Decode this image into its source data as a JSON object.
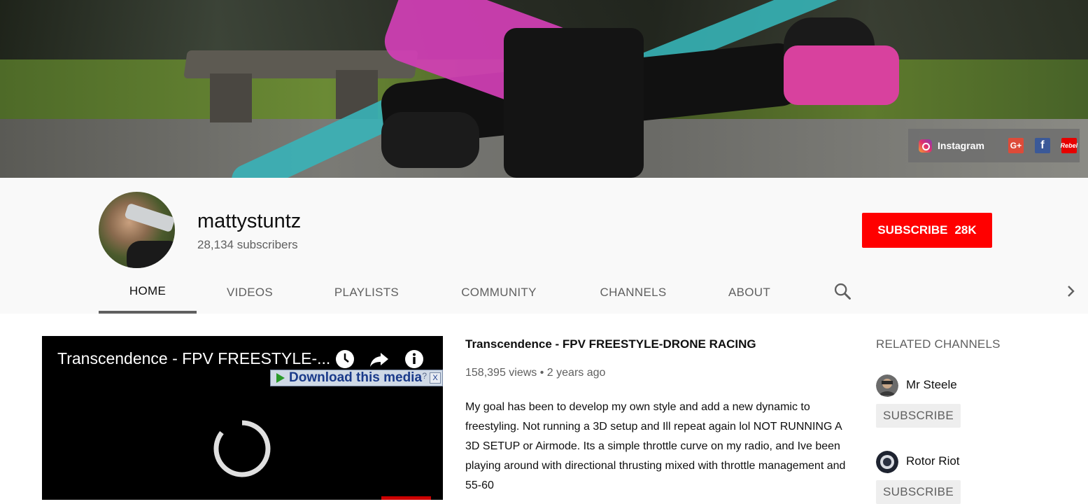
{
  "banner": {
    "links": {
      "instagram_label": "Instagram",
      "google_plus_label": "G+",
      "facebook_label": "f",
      "extra_label": "Rebel"
    }
  },
  "channel": {
    "name": "mattystuntz",
    "subscribers": "28,134 subscribers",
    "subscribe_label": "SUBSCRIBE",
    "subscribe_count": "28K"
  },
  "tabs": [
    {
      "label": "HOME",
      "active": true
    },
    {
      "label": "VIDEOS"
    },
    {
      "label": "PLAYLISTS"
    },
    {
      "label": "COMMUNITY"
    },
    {
      "label": "CHANNELS"
    },
    {
      "label": "ABOUT"
    }
  ],
  "player": {
    "title": "Transcendence - FPV FREESTYLE-...",
    "download_label": "Download this media",
    "download_help": "?",
    "download_close": "X"
  },
  "featured": {
    "title": "Transcendence - FPV FREESTYLE-DRONE RACING",
    "views": "158,395 views",
    "age": "2 years ago",
    "description": "My goal has been to develop my own style and add a new dynamic to freestyling. Not running a 3D setup and Ill repeat again lol NOT RUNNING A 3D SETUP or Airmode. Its a simple throttle curve on my radio, and Ive been playing around with directional thrusting mixed with throttle management and 55-60"
  },
  "related": {
    "heading": "RELATED CHANNELS",
    "channels": [
      {
        "name": "Mr Steele",
        "subscribe_label": "SUBSCRIBE"
      },
      {
        "name": "Rotor Riot",
        "subscribe_label": "SUBSCRIBE"
      }
    ]
  },
  "colors": {
    "accent_red": "#ff0000",
    "tab_text": "#606060",
    "header_bg": "#f9f9f9"
  }
}
